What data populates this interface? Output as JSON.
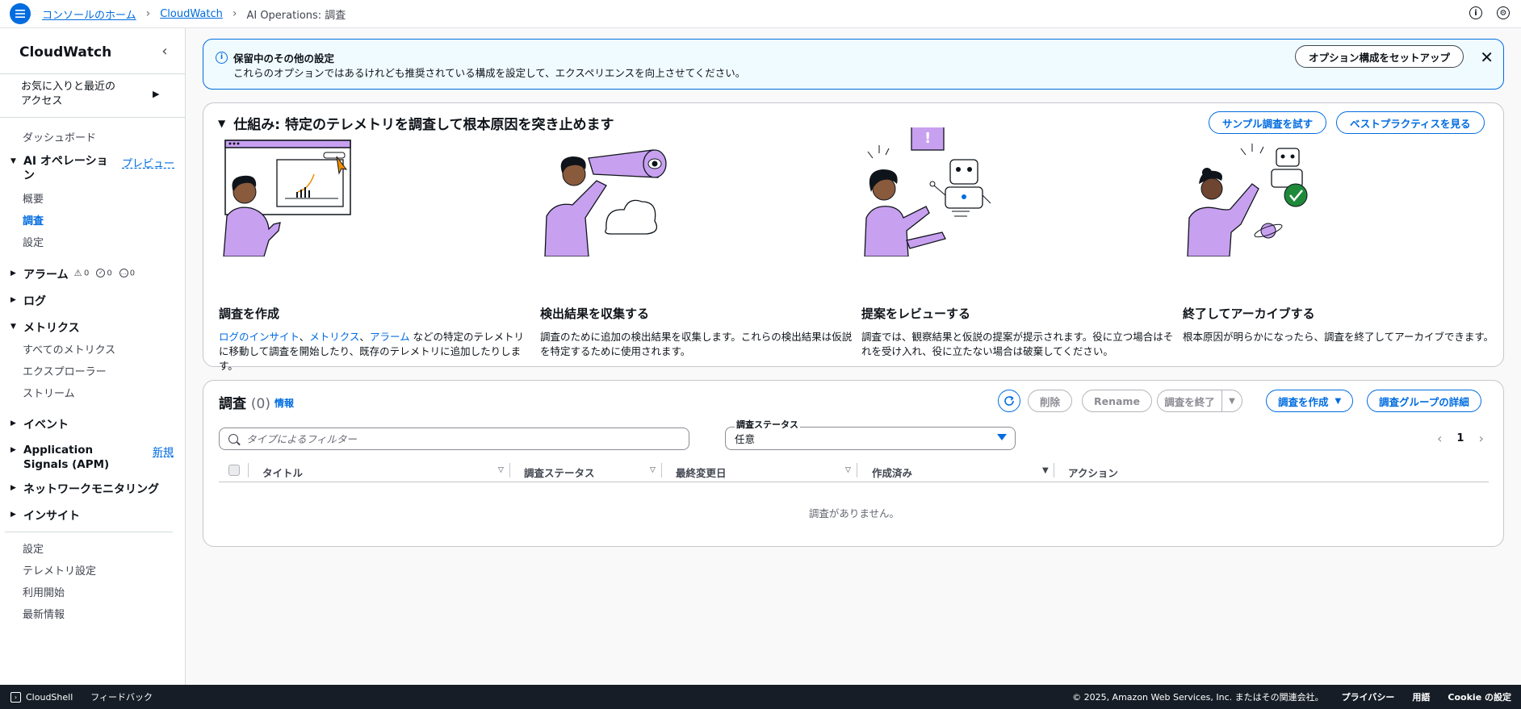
{
  "breadcrumb": {
    "home": "コンソールのホーム",
    "service": "CloudWatch",
    "current": "AI Operations: 調査"
  },
  "sidebar": {
    "title": "CloudWatch",
    "favorites": "お気に入りと最近のアクセス",
    "dashboard": "ダッシュボード",
    "ai_ops": "AI オペレーション",
    "ai_ops_badge": "プレビュー",
    "ai_items": [
      "概要",
      "調査",
      "設定"
    ],
    "alarms": "アラーム",
    "alarm_counts": [
      "0",
      "0",
      "0"
    ],
    "logs": "ログ",
    "metrics": "メトリクス",
    "metric_items": [
      "すべてのメトリクス",
      "エクスプローラー",
      "ストリーム"
    ],
    "events": "イベント",
    "app_signals": "Application Signals (APM)",
    "app_signals_badge": "新規",
    "network": "ネットワークモニタリング",
    "insights": "インサイト",
    "bottom_items": [
      "設定",
      "テレメトリ設定",
      "利用開始",
      "最新情報"
    ]
  },
  "banner": {
    "title": "保留中のその他の設定",
    "text": "これらのオプションではあるけれども推奨されている構成を設定して、エクスペリエンスを向上させてください。",
    "button": "オプション構成をセットアップ"
  },
  "how": {
    "title": "仕組み: 特定のテレメトリを調査して根本原因を突き止めます",
    "try_sample": "サンプル調査を試す",
    "best_practices": "ベストプラクティスを見る",
    "steps": [
      {
        "title": "調査を作成",
        "link1": "ログのインサイト",
        "sep1": "、",
        "link2": "メトリクス",
        "sep2": "、",
        "link3": "アラーム",
        "text": " などの特定のテレメトリに移動して調査を開始したり、既存のテレメトリに追加したりします。"
      },
      {
        "title": "検出結果を収集する",
        "text": "調査のために追加の検出結果を収集します。これらの検出結果は仮説を特定するために使用されます。"
      },
      {
        "title": "提案をレビューする",
        "text": "調査では、観察結果と仮説の提案が提示されます。役に立つ場合はそれを受け入れ、役に立たない場合は破棄してください。"
      },
      {
        "title": "終了してアーカイブする",
        "text": "根本原因が明らかになったら、調査を終了してアーカイブできます。"
      }
    ]
  },
  "investigations": {
    "title": "調査",
    "count": "(0)",
    "info": "情報",
    "delete": "削除",
    "rename": "Rename",
    "end": "調査を終了",
    "create": "調査を作成",
    "group_details": "調査グループの詳細",
    "filter_placeholder": "タイプによるフィルター",
    "status_label": "調査ステータス",
    "status_value": "任意",
    "page": "1",
    "columns": [
      "タイトル",
      "調査ステータス",
      "最終変更日",
      "作成済み",
      "アクション"
    ],
    "empty": "調査がありません。"
  },
  "footer": {
    "cloudshell": "CloudShell",
    "feedback": "フィードバック",
    "copyright": "© 2025, Amazon Web Services, Inc. またはその関連会社。",
    "privacy": "プライバシー",
    "terms": "用語",
    "cookie": "Cookie の設定"
  },
  "colors": {
    "accent": "#006ce0",
    "illustration": "#c8a0f0",
    "footer_bg": "#161d26"
  }
}
